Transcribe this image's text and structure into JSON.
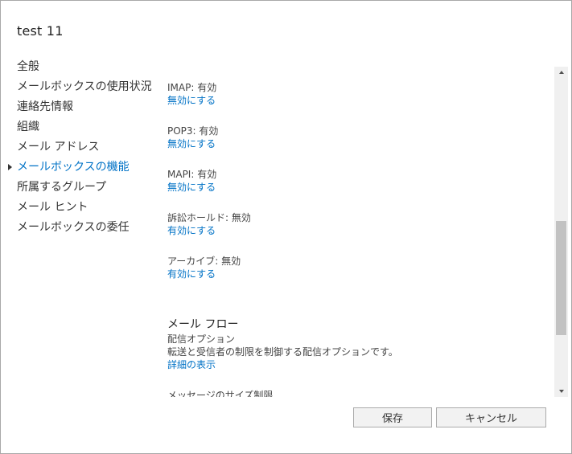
{
  "title": "test 11",
  "nav": {
    "items": [
      {
        "label": "全般"
      },
      {
        "label": "メールボックスの使用状況"
      },
      {
        "label": "連絡先情報"
      },
      {
        "label": "組織"
      },
      {
        "label": "メール アドレス"
      },
      {
        "label": "メールボックスの機能"
      },
      {
        "label": "所属するグループ"
      },
      {
        "label": "メール ヒント"
      },
      {
        "label": "メールボックスの委任"
      }
    ],
    "active_label": "メールボックスの機能"
  },
  "features": {
    "imap": {
      "status": "IMAP: 有効",
      "action": "無効にする"
    },
    "pop3": {
      "status": "POP3: 有効",
      "action": "無効にする"
    },
    "mapi": {
      "status": "MAPI: 有効",
      "action": "無効にする"
    },
    "litigation_hold": {
      "status": "訴訟ホールド: 無効",
      "action": "有効にする"
    },
    "archive": {
      "status": "アーカイブ: 無効",
      "action": "有効にする"
    }
  },
  "mail_flow": {
    "heading": "メール フロー",
    "delivery_options": "配信オプション",
    "delivery_description": "転送と受信者の制限を制御する配信オプションです。",
    "details_link": "詳細の表示",
    "message_size_label": "メッセージのサイズ制限"
  },
  "buttons": {
    "save": "保存",
    "cancel": "キャンセル"
  }
}
